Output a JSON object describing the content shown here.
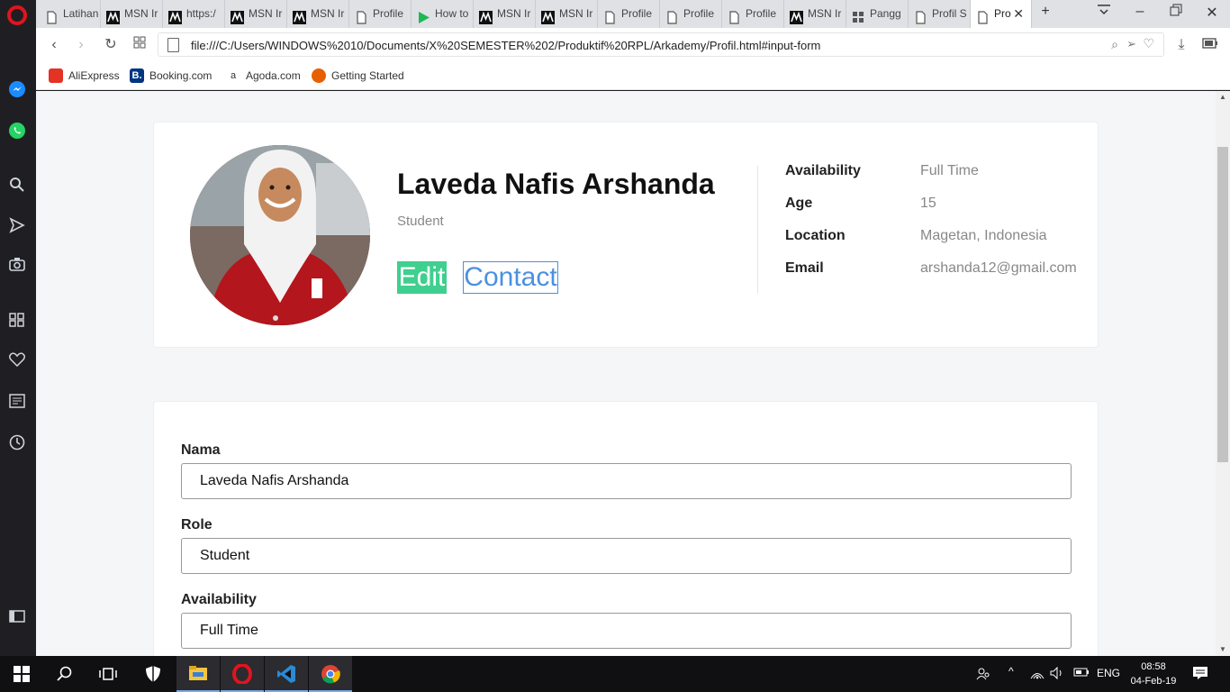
{
  "browser": {
    "tabs": [
      {
        "label": "Latihan",
        "icon": "page-icon"
      },
      {
        "label": "MSN Ir",
        "icon": "msn-icon"
      },
      {
        "label": "https:/",
        "icon": "msn-icon"
      },
      {
        "label": "MSN Ir",
        "icon": "msn-icon"
      },
      {
        "label": "MSN Ir",
        "icon": "msn-icon"
      },
      {
        "label": "Profile",
        "icon": "page-icon"
      },
      {
        "label": "How to",
        "icon": "play-icon"
      },
      {
        "label": "MSN Ir",
        "icon": "msn-icon"
      },
      {
        "label": "MSN Ir",
        "icon": "msn-icon"
      },
      {
        "label": "Profile",
        "icon": "page-icon"
      },
      {
        "label": "Profile",
        "icon": "page-icon"
      },
      {
        "label": "Profile",
        "icon": "page-icon"
      },
      {
        "label": "MSN Ir",
        "icon": "msn-icon"
      },
      {
        "label": "Pangg",
        "icon": "grid-icon"
      },
      {
        "label": "Profil S",
        "icon": "page-icon"
      },
      {
        "label": "Pro",
        "icon": "page-icon"
      }
    ],
    "url": "file:///C:/Users/WINDOWS%2010/Documents/X%20SEMESTER%202/Produktif%20RPL/Arkademy/Profil.html#input-form",
    "bookmarks": [
      {
        "label": "AliExpress",
        "color": "#e43225",
        "glyph": ""
      },
      {
        "label": "Booking.com",
        "color": "#003580",
        "glyph": "B."
      },
      {
        "label": "Agoda.com",
        "color": "#ffffff",
        "glyph": "a"
      },
      {
        "label": "Getting Started",
        "color": "#e66000",
        "glyph": ""
      }
    ]
  },
  "profile": {
    "name": "Laveda Nafis Arshanda",
    "role": "Student",
    "edit_label": "Edit",
    "contact_label": "Contact",
    "info": [
      {
        "label": "Availability",
        "value": "Full Time"
      },
      {
        "label": "Age",
        "value": "15"
      },
      {
        "label": "Location",
        "value": "Magetan, Indonesia"
      },
      {
        "label": "Email",
        "value": "arshanda12@gmail.com"
      }
    ]
  },
  "form": {
    "fields": [
      {
        "label": "Nama",
        "value": "Laveda Nafis Arshanda"
      },
      {
        "label": "Role",
        "value": "Student"
      },
      {
        "label": "Availability",
        "value": "Full Time"
      }
    ]
  },
  "taskbar": {
    "lang": "ENG",
    "time": "08:58",
    "date": "04-Feb-19"
  },
  "colors": {
    "edit_green": "#3fcf8e",
    "contact_blue": "#4a90e2",
    "opera_red": "#e0141e"
  }
}
